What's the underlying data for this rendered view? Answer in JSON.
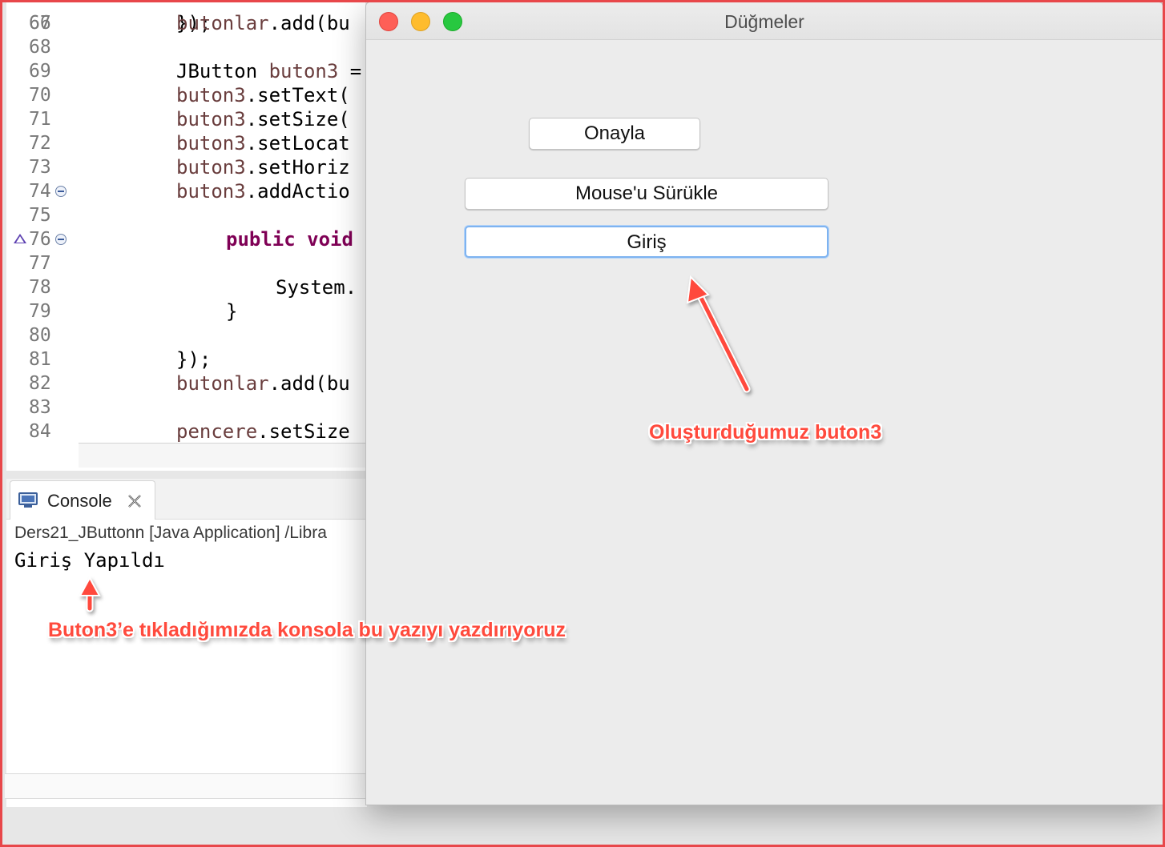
{
  "editor": {
    "lines": [
      {
        "num": "67",
        "segments": [
          {
            "t": "butonlar",
            "c": "var"
          },
          {
            "t": ".add(bu",
            "c": ""
          }
        ]
      },
      {
        "num": "68",
        "segments": []
      },
      {
        "num": "69",
        "segments": [
          {
            "t": "JButton ",
            "c": ""
          },
          {
            "t": "buton3",
            "c": "var"
          },
          {
            "t": " =",
            "c": ""
          }
        ]
      },
      {
        "num": "70",
        "segments": [
          {
            "t": "buton3",
            "c": "var"
          },
          {
            "t": ".setText(",
            "c": ""
          }
        ]
      },
      {
        "num": "71",
        "segments": [
          {
            "t": "buton3",
            "c": "var"
          },
          {
            "t": ".setSize(",
            "c": ""
          }
        ]
      },
      {
        "num": "72",
        "segments": [
          {
            "t": "buton3",
            "c": "var"
          },
          {
            "t": ".setLocat",
            "c": ""
          }
        ]
      },
      {
        "num": "73",
        "segments": [
          {
            "t": "buton3",
            "c": "var"
          },
          {
            "t": ".setHoriz",
            "c": ""
          }
        ]
      },
      {
        "num": "74",
        "segments": [
          {
            "t": "buton3",
            "c": "var"
          },
          {
            "t": ".addActio",
            "c": ""
          }
        ]
      },
      {
        "num": "75",
        "segments": []
      },
      {
        "num": "76",
        "segments": [
          {
            "t": "public void",
            "c": "kw"
          }
        ]
      },
      {
        "num": "77",
        "segments": []
      },
      {
        "num": "78",
        "segments": [
          {
            "t": "System.",
            "c": ""
          }
        ]
      },
      {
        "num": "79",
        "segments": [
          {
            "t": "}",
            "c": ""
          }
        ]
      },
      {
        "num": "80",
        "segments": []
      },
      {
        "num": "81",
        "segments": [
          {
            "t": "});",
            "c": ""
          }
        ]
      },
      {
        "num": "82",
        "segments": [
          {
            "t": "butonlar",
            "c": "var"
          },
          {
            "t": ".add(bu",
            "c": ""
          }
        ]
      },
      {
        "num": "83",
        "segments": []
      },
      {
        "num": "84",
        "segments": [
          {
            "t": "pencere",
            "c": "var"
          },
          {
            "t": ".setSize",
            "c": ""
          }
        ]
      }
    ]
  },
  "console": {
    "tab_label": "Console",
    "description": "Ders21_JButtonn [Java Application] /Libra",
    "output": "Giriş Yapıldı"
  },
  "window": {
    "title": "Düğmeler",
    "buttons": {
      "onayla": "Onayla",
      "surukle": "Mouse'u Sürükle",
      "giris": "Giriş"
    }
  },
  "annotations": {
    "buton3_callout": "Oluşturduğumuz buton3",
    "console_callout": "Buton3’e tıkladığımızda konsola bu yazıyı yazdırıyoruz"
  },
  "colors": {
    "annotation": "#ff4a3d",
    "frame_border": "#e8474a",
    "focus_ring": "#7eb3f0"
  }
}
